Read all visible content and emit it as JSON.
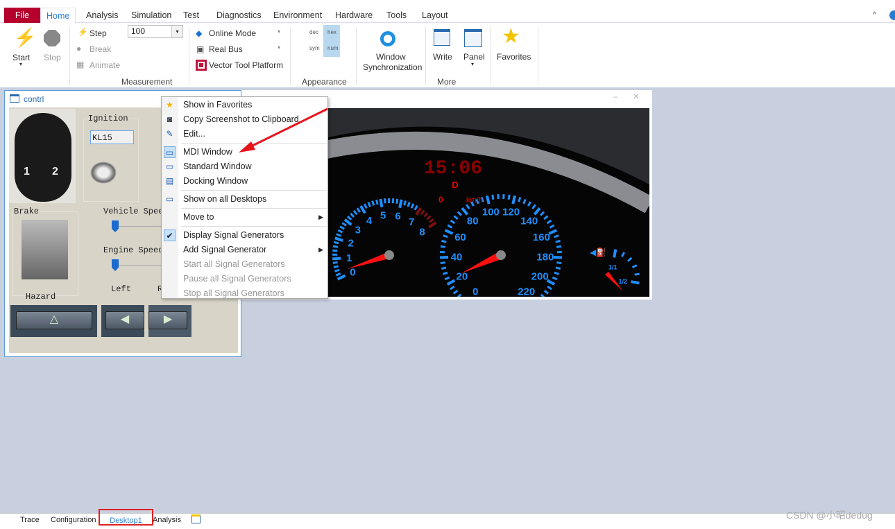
{
  "ribbon": {
    "tabs": [
      "File",
      "Home",
      "Analysis",
      "Simulation",
      "Test",
      "Diagnostics",
      "Environment",
      "Hardware",
      "Tools",
      "Layout"
    ],
    "active_tab": "Home",
    "start": "Start",
    "stop": "Stop",
    "step": "Step",
    "break": "Break",
    "animate": "Animate",
    "step_value": "100",
    "online_mode": "Online Mode",
    "real_bus": "Real Bus",
    "vector_tool_platform": "Vector Tool Platform",
    "dec": "dec",
    "hex": "hex",
    "sym": "sym",
    "num": "num",
    "window_sync_1": "Window",
    "window_sync_2": "Synchronization",
    "write": "Write",
    "panel": "Panel",
    "favorites": "Favorites",
    "groups": {
      "measurement": "Measurement",
      "appearance": "Appearance",
      "more": "More"
    }
  },
  "contrl": {
    "title": "contrl",
    "ignition": "Ignition",
    "ignition_value": "KL15",
    "brake": "Brake",
    "vehicle_speed": "Vehicle Speed",
    "engine_speed": "Engine Speed",
    "left": "Left",
    "right": "Ri",
    "hazard": "Hazard",
    "key_buttons": [
      "1",
      "2"
    ]
  },
  "dashboard": {
    "clock": "15:06",
    "gear": "D",
    "speed": "0",
    "unit": "km/h",
    "tach_labels": [
      "0",
      "1",
      "2",
      "3",
      "4",
      "5",
      "6",
      "7",
      "8"
    ],
    "speed_labels": [
      "0",
      "20",
      "40",
      "60",
      "80",
      "100",
      "120",
      "140",
      "160",
      "180",
      "200",
      "220"
    ],
    "fuel_labels": [
      "1/1",
      "1/2"
    ],
    "accent": "#1e8fff",
    "needle": "#ff1010"
  },
  "context_menu": {
    "items": [
      {
        "label": "Show in Favorites",
        "icon": "star-icon"
      },
      {
        "label": "Copy Screenshot to Clipboard",
        "icon": "camera-icon"
      },
      {
        "label": "Edit...",
        "icon": "pencil-icon"
      },
      {
        "label": "MDI Window",
        "icon": "mdi-window-icon",
        "checked": true
      },
      {
        "label": "Standard Window",
        "icon": "standard-window-icon"
      },
      {
        "label": "Docking Window",
        "icon": "docking-window-icon"
      },
      {
        "label": "Show on all Desktops",
        "icon": "desktops-icon"
      },
      {
        "label": "Move to",
        "submenu": true
      },
      {
        "label": "Display Signal Generators",
        "icon": "check-icon",
        "checked": true
      },
      {
        "label": "Add Signal Generator",
        "submenu": true
      },
      {
        "label": "Start all Signal Generators",
        "disabled": true
      },
      {
        "label": "Pause all Signal Generators",
        "disabled": true
      },
      {
        "label": "Stop all Signal Generators",
        "disabled": true
      }
    ]
  },
  "bottom_tabs": {
    "items": [
      "Trace",
      "Configuration",
      "Desktop1",
      "Analysis"
    ],
    "active": "Desktop1"
  },
  "watermark": "CSDN @小昭dedug"
}
